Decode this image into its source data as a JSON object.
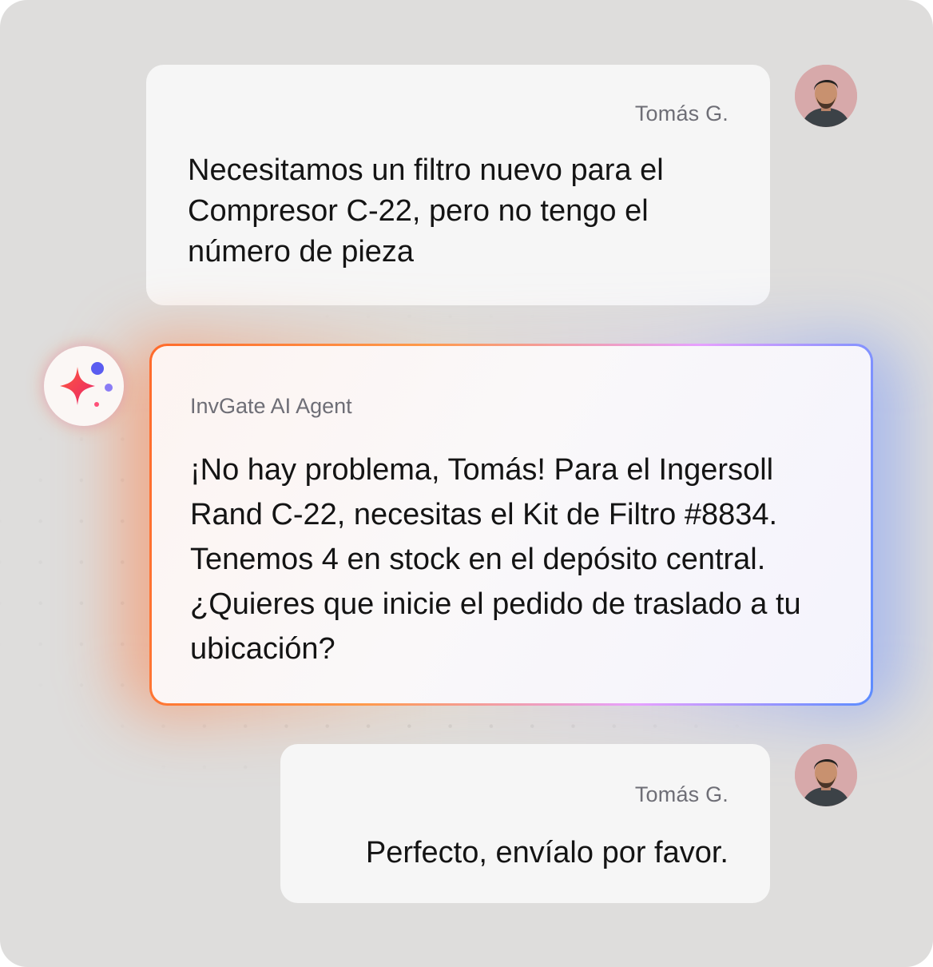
{
  "messages": [
    {
      "sender": "Tomás G.",
      "text": "Necesitamos un filtro nuevo para el Compresor C-22, pero no tengo el número de pieza"
    },
    {
      "sender": "InvGate AI Agent",
      "text": "¡No hay problema, Tomás! Para el Ingersoll Rand C-22, necesitas el Kit de Filtro #8834. Tenemos 4 en stock en el depósito central. ¿Quieres que inicie el pedido de traslado a tu ubicación?"
    },
    {
      "sender": "Tomás G.",
      "text": "Perfecto, envíalo por favor."
    }
  ],
  "colors": {
    "background": "#dedddc",
    "bubble": "#f6f6f6",
    "ai_gradient_start": "#ff6a2b",
    "ai_gradient_end": "#5b8cff",
    "sender_text": "#6e6e76"
  },
  "icons": {
    "user_avatar": "user-avatar-photo",
    "ai_avatar": "sparkle-icon"
  }
}
